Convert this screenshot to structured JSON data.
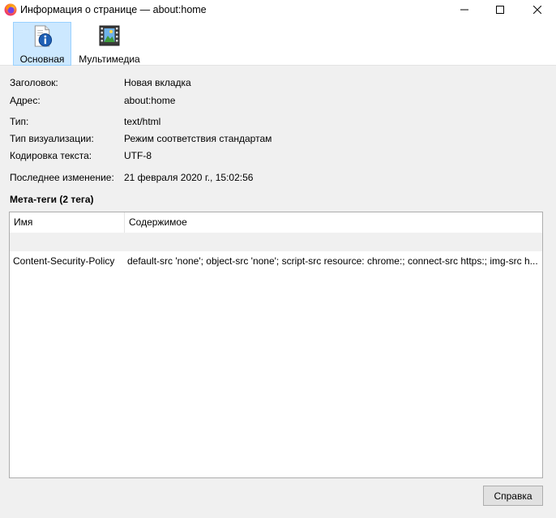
{
  "window": {
    "title": "Информация о странице — about:home",
    "icon": "firefox-icon"
  },
  "toolbar": {
    "tabs": [
      {
        "label": "Основная",
        "icon": "info-document-icon",
        "selected": true
      },
      {
        "label": "Мультимедиа",
        "icon": "media-film-icon",
        "selected": false
      }
    ]
  },
  "general": {
    "title_label": "Заголовок:",
    "title_value": "Новая вкладка",
    "address_label": "Адрес:",
    "address_value": "about:home",
    "type_label": "Тип:",
    "type_value": "text/html",
    "render_label": "Тип визуализации:",
    "render_value": "Режим соответствия стандартам",
    "encoding_label": "Кодировка текста:",
    "encoding_value": "UTF-8",
    "modified_label": "Последнее изменение:",
    "modified_value": "21 февраля 2020 г., 15:02:56"
  },
  "meta": {
    "heading": "Мета-теги (2 тега)",
    "columns": {
      "name": "Имя",
      "content": "Содержимое"
    },
    "rows": [
      {
        "name": "Content-Security-Policy",
        "content": "default-src 'none'; object-src 'none'; script-src resource: chrome:; connect-src https:; img-src h..."
      }
    ]
  },
  "footer": {
    "help_label": "Справка"
  },
  "colors": {
    "selected_tab_bg": "#cce8ff",
    "selected_tab_border": "#99d1ff",
    "window_bg": "#f0f0f0"
  }
}
